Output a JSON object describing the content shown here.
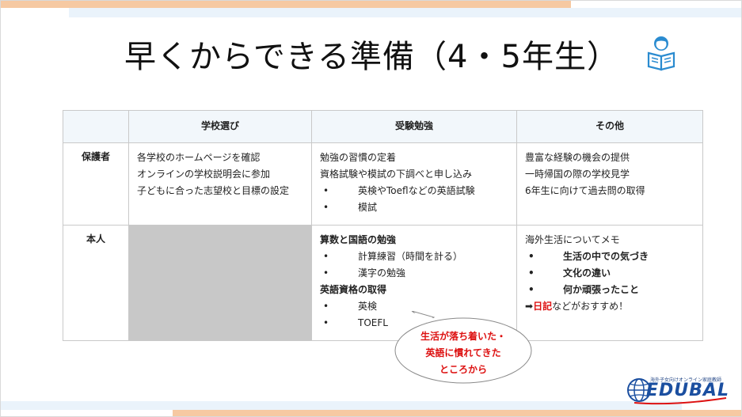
{
  "title": "早くからできる準備（4・5年生）",
  "table": {
    "headers": [
      "",
      "学校選び",
      "受験勉強",
      "その他"
    ],
    "rows": [
      {
        "label": "保護者",
        "school": [
          "各学校のホームページを確認",
          "オンラインの学校説明会に参加",
          "子どもに合った志望校と目標の設定"
        ],
        "study_lines": [
          "勉強の習慣の定着",
          "資格試験や模試の下調べと申し込み"
        ],
        "study_bullets": [
          "英検やToeflなどの英語試験",
          "模試"
        ],
        "other": [
          "豊富な経験の機会の提供",
          "一時帰国の際の学校見学",
          "6年生に向けて過去問の取得"
        ]
      },
      {
        "label": "本人",
        "study_head1": "算数と国語の勉強",
        "study_bullets1": [
          "計算練習（時間を計る）",
          "漢字の勉強"
        ],
        "study_head2": "英語資格の取得",
        "study_bullets2": [
          "英検",
          "TOEFL"
        ],
        "other_intro": "海外生活についてメモ",
        "other_bullets": [
          "生活の中での気づき",
          "文化の違い",
          "何か頑張ったこと"
        ],
        "other_arrow": "➡",
        "other_highlight": "日記",
        "other_tail": "などがおすすめ！"
      }
    ]
  },
  "bubble": {
    "line1": "生活が落ち着いた・",
    "line2": "英語に慣れてきた",
    "line3": "ところから"
  },
  "logo": {
    "small": "海外子女向けオンライン家庭教師",
    "name": "EDUBAL"
  },
  "bullet_char": "•",
  "colors": {
    "accent_red": "#d11111",
    "header_bg": "#f2f7fb",
    "orange_bar": "#f6c9a2",
    "blue_bar": "#eaf3fb"
  },
  "icons": {
    "reader": "person-reading-icon",
    "globe": "globe-icon"
  }
}
